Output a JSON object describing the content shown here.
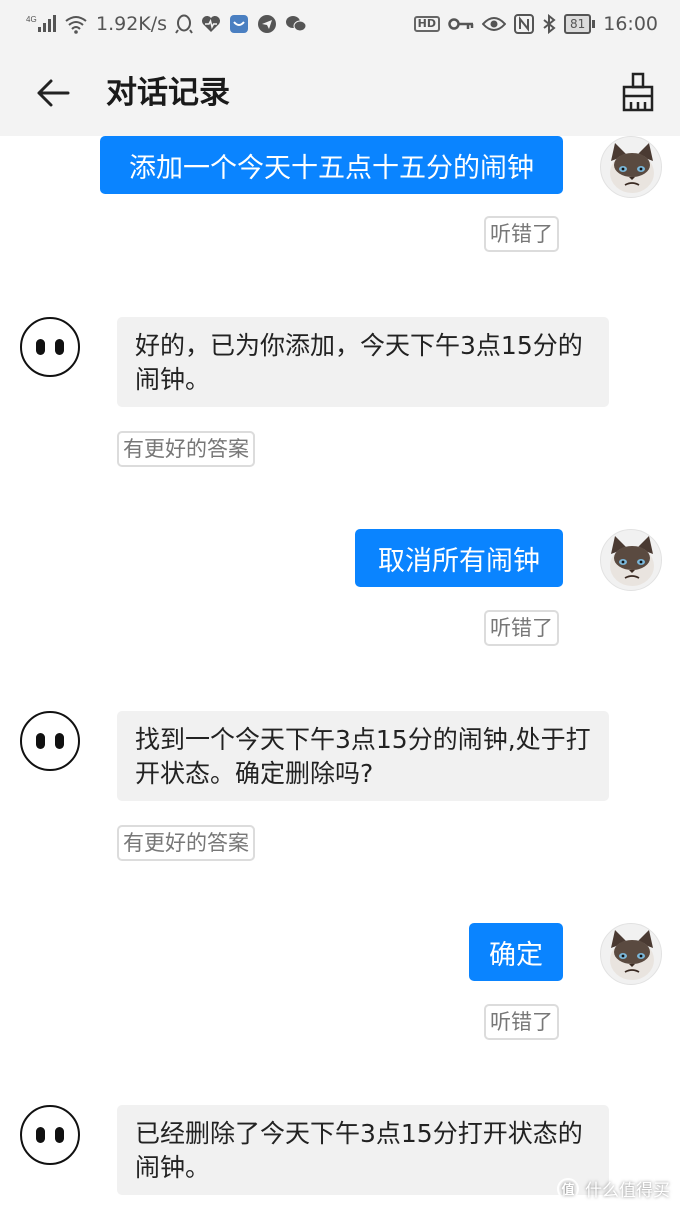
{
  "status_bar": {
    "signal": "4G",
    "net_speed": "1.92K/s",
    "hd_badge": "HD",
    "battery": "81",
    "time": "16:00",
    "icons_left": [
      "signal-icon",
      "wifi-icon",
      "qq-icon",
      "heart-icon",
      "app-icon",
      "telegram-icon",
      "wechat-icon"
    ],
    "icons_right": [
      "hd-icon",
      "key-icon",
      "eye-icon",
      "nfc-icon",
      "bluetooth-icon",
      "battery-icon"
    ]
  },
  "header": {
    "title": "对话记录",
    "back_icon": "arrow-left-icon",
    "clear_icon": "broom-icon"
  },
  "messages": [
    {
      "from": "user",
      "text": "添加一个今天十五点十五分的闹钟",
      "feedback": "听错了"
    },
    {
      "from": "bot",
      "text": "好的，已为你添加，今天下午3点15分的闹钟。",
      "feedback": "有更好的答案"
    },
    {
      "from": "user",
      "text": "取消所有闹钟",
      "feedback": "听错了"
    },
    {
      "from": "bot",
      "text": "找到一个今天下午3点15分的闹钟,处于打开状态。确定删除吗?",
      "feedback": "有更好的答案"
    },
    {
      "from": "user",
      "text": "确定",
      "feedback": "听错了"
    },
    {
      "from": "bot",
      "text": "已经删除了今天下午3点15分打开状态的闹钟。"
    }
  ],
  "watermark": {
    "logo": "值",
    "text": "什么值得买"
  },
  "colors": {
    "user_bubble": "#0a84ff",
    "bot_bubble": "#f1f1f1",
    "bars": "#f3f3f3"
  }
}
